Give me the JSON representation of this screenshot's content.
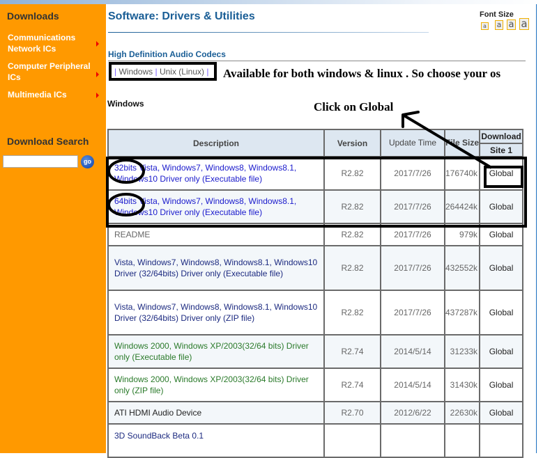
{
  "sidebar": {
    "title": "Downloads",
    "items": [
      {
        "label": "Communications Network ICs"
      },
      {
        "label": "Computer Peripheral ICs"
      },
      {
        "label": "Multimedia ICs"
      }
    ],
    "search_title": "Download Search",
    "search_value": "",
    "go_label": "go"
  },
  "header": {
    "title": "Software: Drivers & Utilities",
    "font_size_label": "Font Size",
    "font_size_options": [
      "a",
      "a",
      "a",
      "a"
    ]
  },
  "section": {
    "subtitle": "High Definition Audio Codecs",
    "os_links": [
      "Windows",
      "Unix (Linux)"
    ],
    "os_label": "Windows"
  },
  "annotations": {
    "os_note": "Available for both windows & linux . So choose your os",
    "click_note": "Click on Global"
  },
  "table": {
    "headers": {
      "description": "Description",
      "version": "Version",
      "update_time": "Update Time",
      "file_size": "File Size",
      "download": "Download",
      "site1": "Site 1"
    },
    "rows": [
      {
        "description": "32bits Vista, Windows7, Windows8, Windows8.1, Windows10 Driver only (Executable file)",
        "version": "R2.82",
        "update": "2017/7/26",
        "size": "176740k",
        "download": "Global"
      },
      {
        "description": "64bits Vista, Windows7, Windows8, Windows8.1, Windows10 Driver only (Executable file)",
        "version": "R2.82",
        "update": "2017/7/26",
        "size": "264424k",
        "download": "Global"
      },
      {
        "description": "README",
        "version": "R2.82",
        "update": "2017/7/26",
        "size": "979k",
        "download": "Global"
      },
      {
        "description": "Vista, Windows7, Windows8, Windows8.1, Windows10 Driver (32/64bits) Driver only (Executable file)",
        "version": "R2.82",
        "update": "2017/7/26",
        "size": "432552k",
        "download": "Global"
      },
      {
        "description": "Vista, Windows7, Windows8, Windows8.1, Windows10 Driver (32/64bits) Driver only (ZIP file)",
        "version": "R2.82",
        "update": "2017/7/26",
        "size": "437287k",
        "download": "Global"
      },
      {
        "description": "Windows 2000, Windows XP/2003(32/64 bits) Driver only (Executable file)",
        "version": "R2.74",
        "update": "2014/5/14",
        "size": "31233k",
        "download": "Global"
      },
      {
        "description": "Windows 2000, Windows XP/2003(32/64 bits) Driver only (ZIP file)",
        "version": "R2.74",
        "update": "2014/5/14",
        "size": "31430k",
        "download": "Global"
      },
      {
        "description": "ATI HDMI Audio Device",
        "version": "R2.70",
        "update": "2012/6/22",
        "size": "22630k",
        "download": "Global"
      },
      {
        "description": "3D SoundBack Beta 0.1",
        "version": "",
        "update": "",
        "size": "",
        "download": ""
      }
    ]
  },
  "colors": {
    "sidebar_bg": "#ff9900",
    "title_blue": "#1a5e96",
    "header_bg": "#dde7f1",
    "link_blue": "#1a1acc",
    "link_green": "#2a7a2a"
  }
}
